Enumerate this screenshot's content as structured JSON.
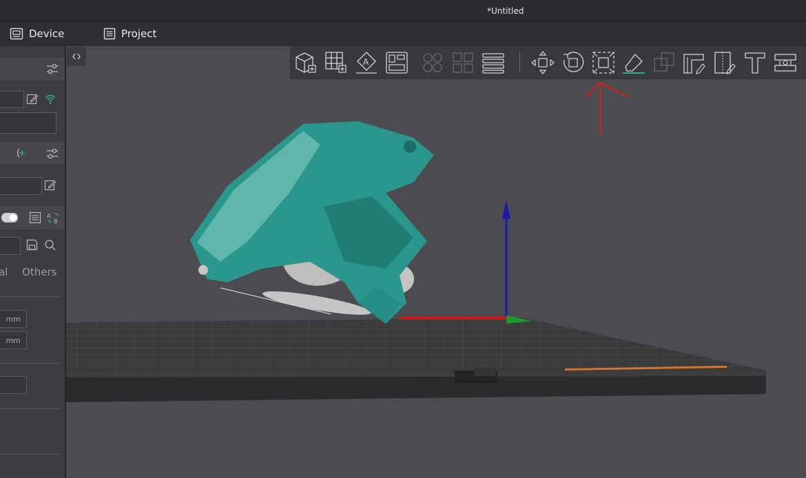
{
  "window": {
    "title": "*Untitled"
  },
  "tabs": [
    {
      "label": "Device",
      "icon": "device-icon"
    },
    {
      "label": "Project",
      "icon": "project-icon"
    }
  ],
  "sidebar": {
    "units": [
      "mm",
      "mm"
    ],
    "tabs": [
      "al",
      "Others"
    ],
    "toggle_on": true
  },
  "toolbar": {
    "tools": [
      "add-object-icon",
      "arrange-grid-icon",
      "auto-orient-icon",
      "layout-icon",
      "split-objects-icon",
      "split-parts-icon",
      "layers-icon",
      "move-icon",
      "rotate-icon",
      "scale-icon",
      "paint-icon",
      "boolean-icon",
      "support-paint-icon",
      "cut-icon",
      "text-icon",
      "measure-icon"
    ]
  },
  "colors": {
    "model": "#2a968c",
    "annotation": "#d81e1e",
    "accent_wifi": "#22b39a",
    "axis_z": "#1a1aa8",
    "axis_x": "#cc1a1a",
    "axis_y": "#1a9a2a"
  }
}
